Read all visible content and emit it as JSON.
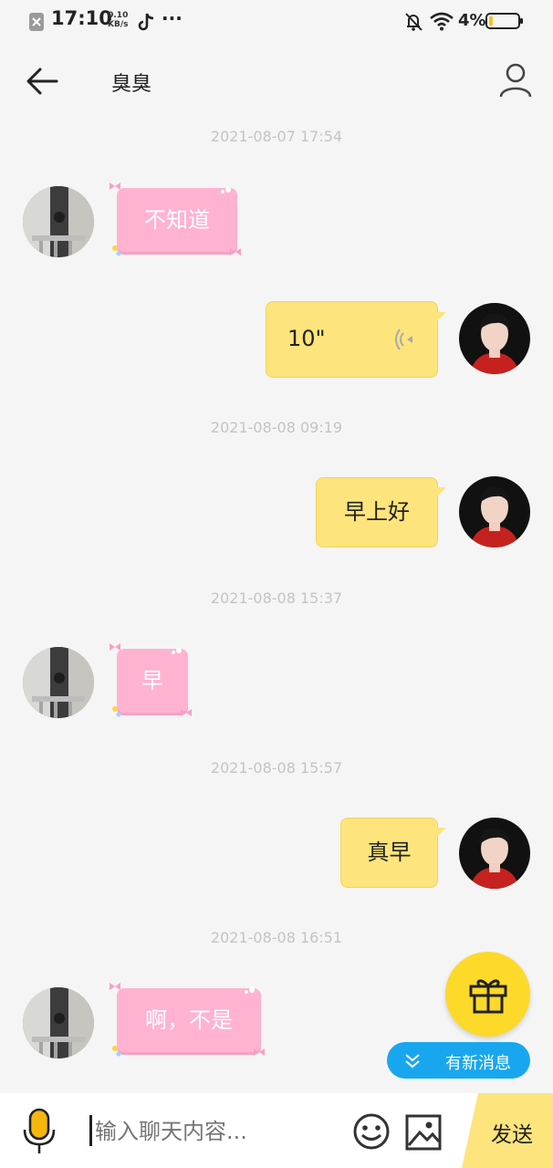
{
  "status_bar": {
    "time": "17:10",
    "net_speed_value": "0.10",
    "net_speed_unit": "KB/s",
    "battery": "4%",
    "more": "···"
  },
  "header": {
    "title": "臭臭",
    "back_icon": "arrow-left-icon",
    "profile_icon": "person-icon"
  },
  "messages": [
    {
      "type": "timestamp",
      "text": "2021-08-07 17:54"
    },
    {
      "type": "received",
      "text": "不知道"
    },
    {
      "type": "sent_voice",
      "text": "10\""
    },
    {
      "type": "timestamp",
      "text": "2021-08-08 09:19"
    },
    {
      "type": "sent",
      "text": "早上好"
    },
    {
      "type": "timestamp",
      "text": "2021-08-08 15:37"
    },
    {
      "type": "received",
      "text": "早"
    },
    {
      "type": "timestamp",
      "text": "2021-08-08 15:57"
    },
    {
      "type": "sent",
      "text": "真早"
    },
    {
      "type": "timestamp",
      "text": "2021-08-08 16:51"
    },
    {
      "type": "received",
      "text": "啊，不是"
    }
  ],
  "new_message_label": "有新消息",
  "input": {
    "placeholder": "输入聊天内容...",
    "send_label": "发送"
  },
  "colors": {
    "pink_bubble": "#ffb3d1",
    "yellow_bubble": "#fde47c",
    "accent_blue": "#18a7ef",
    "gift_yellow": "#fdd92a"
  }
}
